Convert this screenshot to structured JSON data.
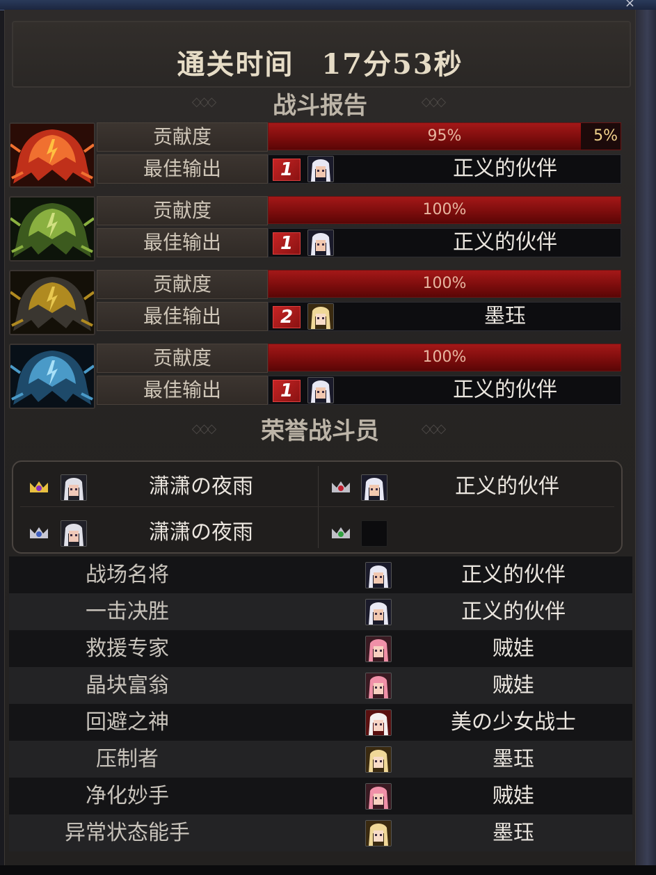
{
  "window": {
    "title": "战斗报告",
    "close_glyph": "×"
  },
  "header": {
    "clear_time_label": "通关时间",
    "clear_time_value": "17分53秒"
  },
  "battle_report": {
    "title": "战斗报告",
    "rows": [
      {
        "boss_icon": "red-flame-helm-icon",
        "contribution_label": "贡献度",
        "contribution_percent": 95,
        "contribution_text": "95%",
        "remainder_text": "5%",
        "best_output_label": "最佳输出",
        "best_rank": "1",
        "best_player": "正义的伙伴"
      },
      {
        "boss_icon": "green-thorn-helm-icon",
        "contribution_label": "贡献度",
        "contribution_percent": 100,
        "contribution_text": "100%",
        "remainder_text": "",
        "best_output_label": "最佳输出",
        "best_rank": "1",
        "best_player": "正义的伙伴"
      },
      {
        "boss_icon": "gold-dark-helm-icon",
        "contribution_label": "贡献度",
        "contribution_percent": 100,
        "contribution_text": "100%",
        "remainder_text": "",
        "best_output_label": "最佳输出",
        "best_rank": "2",
        "best_player": "墨珏"
      },
      {
        "boss_icon": "blue-ice-helm-icon",
        "contribution_label": "贡献度",
        "contribution_percent": 100,
        "contribution_text": "100%",
        "remainder_text": "",
        "best_output_label": "最佳输出",
        "best_rank": "1",
        "best_player": "正义的伙伴"
      }
    ]
  },
  "honor": {
    "title": "荣誉战斗员",
    "entries": [
      {
        "crown": "gold-crown-icon",
        "name": "潇潇の夜雨"
      },
      {
        "crown": "red-gem-crown-icon",
        "name": "正义的伙伴"
      },
      {
        "crown": "silver-crown-icon",
        "name": "潇潇の夜雨"
      },
      {
        "crown": "green-gem-crown-icon",
        "name": ""
      }
    ]
  },
  "awards": [
    {
      "title": "战场名将",
      "player": "正义的伙伴",
      "avatar": "white-hair-avatar"
    },
    {
      "title": "一击决胜",
      "player": "正义的伙伴",
      "avatar": "white-hair-avatar"
    },
    {
      "title": "救援专家",
      "player": "贼娃",
      "avatar": "pink-hair-avatar"
    },
    {
      "title": "晶块富翁",
      "player": "贼娃",
      "avatar": "pink-hair-avatar"
    },
    {
      "title": "回避之神",
      "player": "美の少女战士",
      "avatar": "red-white-hair-avatar"
    },
    {
      "title": "压制者",
      "player": "墨珏",
      "avatar": "blonde-avatar"
    },
    {
      "title": "净化妙手",
      "player": "贼娃",
      "avatar": "pink-hair-avatar"
    },
    {
      "title": "异常状态能手",
      "player": "墨珏",
      "avatar": "blonde-avatar"
    }
  ],
  "colors": {
    "bar_red": "#a41818",
    "remainder_gold": "#f1d28b",
    "panel_bg": "#262423"
  }
}
